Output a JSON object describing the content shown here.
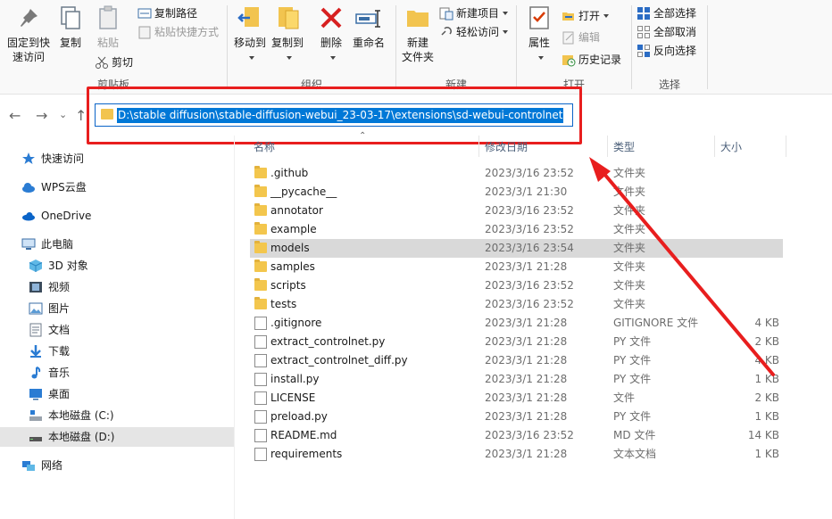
{
  "ribbon": {
    "clipboard": {
      "pin_label_line1": "固定到快",
      "pin_label_line2": "速访问",
      "copy_label": "复制",
      "paste_label": "粘贴",
      "copy_path_label": "复制路径",
      "paste_shortcut_label": "粘贴快捷方式",
      "cut_label": "剪切",
      "group_label": "剪贴板"
    },
    "organize": {
      "move_to_label": "移动到",
      "copy_to_label": "复制到",
      "delete_label": "删除",
      "rename_label": "重命名",
      "group_label": "组织"
    },
    "new": {
      "new_folder_line1": "新建",
      "new_folder_line2": "文件夹",
      "new_item_label": "新建项目",
      "easy_access_label": "轻松访问",
      "group_label": "新建"
    },
    "open": {
      "properties_label": "属性",
      "open_label": "打开",
      "edit_label": "编辑",
      "history_label": "历史记录",
      "group_label": "打开"
    },
    "select": {
      "select_all_label": "全部选择",
      "select_none_label": "全部取消",
      "invert_label": "反向选择",
      "group_label": "选择"
    }
  },
  "address": {
    "path": "D:\\stable diffusion\\stable-diffusion-webui_23-03-17\\extensions\\sd-webui-controlnet"
  },
  "sidebar": {
    "quick_access": "快速访问",
    "wps": "WPS云盘",
    "onedrive": "OneDrive",
    "this_pc": "此电脑",
    "objects3d": "3D 对象",
    "videos": "视频",
    "pictures": "图片",
    "documents": "文档",
    "downloads": "下载",
    "music": "音乐",
    "desktop": "桌面",
    "drive_c": "本地磁盘 (C:)",
    "drive_d": "本地磁盘 (D:)",
    "network": "网络"
  },
  "columns": {
    "name": "名称",
    "date": "修改日期",
    "type": "类型",
    "size": "大小"
  },
  "files": [
    {
      "name": ".github",
      "date": "2023/3/16 23:52",
      "type": "文件夹",
      "size": "",
      "kind": "folder"
    },
    {
      "name": "__pycache__",
      "date": "2023/3/1 21:30",
      "type": "文件夹",
      "size": "",
      "kind": "folder"
    },
    {
      "name": "annotator",
      "date": "2023/3/16 23:52",
      "type": "文件夹",
      "size": "",
      "kind": "folder"
    },
    {
      "name": "example",
      "date": "2023/3/16 23:52",
      "type": "文件夹",
      "size": "",
      "kind": "folder"
    },
    {
      "name": "models",
      "date": "2023/3/16 23:54",
      "type": "文件夹",
      "size": "",
      "kind": "folder"
    },
    {
      "name": "samples",
      "date": "2023/3/1 21:28",
      "type": "文件夹",
      "size": "",
      "kind": "folder"
    },
    {
      "name": "scripts",
      "date": "2023/3/16 23:52",
      "type": "文件夹",
      "size": "",
      "kind": "folder"
    },
    {
      "name": "tests",
      "date": "2023/3/16 23:52",
      "type": "文件夹",
      "size": "",
      "kind": "folder"
    },
    {
      "name": ".gitignore",
      "date": "2023/3/1 21:28",
      "type": "GITIGNORE 文件",
      "size": "4 KB",
      "kind": "file"
    },
    {
      "name": "extract_controlnet.py",
      "date": "2023/3/1 21:28",
      "type": "PY 文件",
      "size": "2 KB",
      "kind": "file"
    },
    {
      "name": "extract_controlnet_diff.py",
      "date": "2023/3/1 21:28",
      "type": "PY 文件",
      "size": "4 KB",
      "kind": "file"
    },
    {
      "name": "install.py",
      "date": "2023/3/1 21:28",
      "type": "PY 文件",
      "size": "1 KB",
      "kind": "file"
    },
    {
      "name": "LICENSE",
      "date": "2023/3/1 21:28",
      "type": "文件",
      "size": "2 KB",
      "kind": "file"
    },
    {
      "name": "preload.py",
      "date": "2023/3/1 21:28",
      "type": "PY 文件",
      "size": "1 KB",
      "kind": "file"
    },
    {
      "name": "README.md",
      "date": "2023/3/16 23:52",
      "type": "MD 文件",
      "size": "14 KB",
      "kind": "file"
    },
    {
      "name": "requirements",
      "date": "2023/3/1 21:28",
      "type": "文本文档",
      "size": "1 KB",
      "kind": "file"
    }
  ],
  "selected_row": 4,
  "colors": {
    "annotation": "#e81e1e",
    "selection": "#0078d7",
    "folder": "#f3c64d"
  }
}
